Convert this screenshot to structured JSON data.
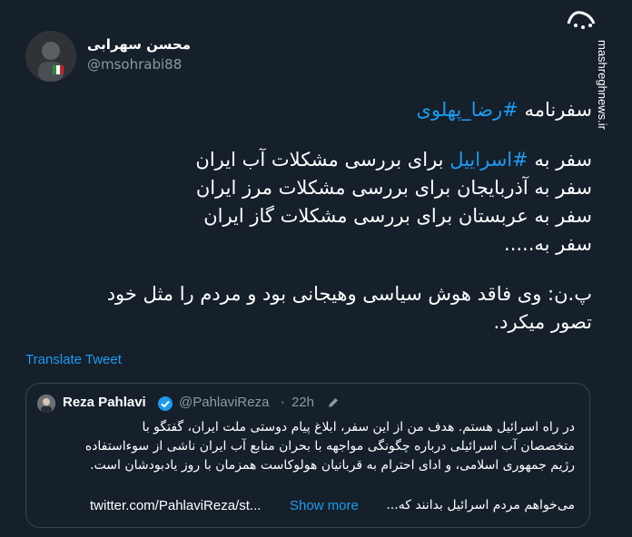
{
  "author": {
    "display_name": "محسن سهرابی",
    "handle": "@msohrabi88"
  },
  "watermark": {
    "logo_text": "مشرق",
    "url": "mashreghnews.ir"
  },
  "tweet": {
    "line1_prefix": "سفرنامه ",
    "line1_hashtag": "#رضا_پهلوی",
    "line2_prefix": "سفر به ",
    "line2_hashtag": "#اسراییل",
    "line2_suffix": " برای بررسی مشکلات آب ایران",
    "line3": "سفر به آذربایجان برای بررسی مشکلات مرز ایران",
    "line4": "سفر به عربستان برای بررسی مشکلات گاز ایران",
    "line5": "سفر به.....",
    "line6": "پ.ن: وی فاقد هوش سیاسی وهیجانی بود و مردم را مثل خود",
    "line7": "تصور میکرد."
  },
  "translate_label": "Translate Tweet",
  "quote": {
    "name": "Reza Pahlavi",
    "handle": "@PahlaviReza",
    "separator": "·",
    "time": "22h",
    "line1": "در راه اسرائیل هستم. هدف من از این سفر، ابلاغ پیام دوستی ملت ایران، گفتگو با",
    "line2": "متخصصان آب اسرائیلی درباره چگونگی مواجهه با بحران منابع آب ایران ناشی از سوءاستفاده",
    "line3": "رژیم جمهوری اسلامی، و ادای احترام به قربانیان هولوکاست همزمان با روز یادبودشان است.",
    "line4_rtl": "می‌خواهم مردم اسرائیل بدانند که...",
    "link": "twitter.com/PahlaviReza/st...",
    "show_more": "Show more"
  },
  "colors": {
    "background": "#15202b",
    "accent": "#1d9bf0",
    "muted": "#8b98a5",
    "border": "#38444d"
  }
}
